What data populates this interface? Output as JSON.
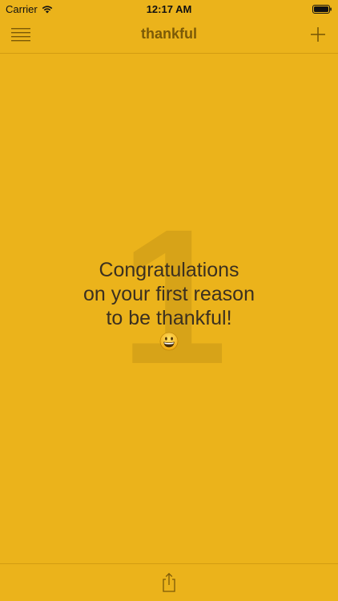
{
  "status_bar": {
    "carrier": "Carrier",
    "time": "12:17 AM",
    "battery_level": 1.0
  },
  "nav_bar": {
    "title": "thankful",
    "menu_icon": "hamburger-menu-icon",
    "add_icon": "plus-icon"
  },
  "content": {
    "background_number": "1",
    "message_lines": [
      "Congratulations",
      "on your first reason",
      "to be thankful!"
    ],
    "emoji": "grinning-face-emoji"
  },
  "bottom_bar": {
    "share_icon": "share-icon"
  },
  "colors": {
    "background": "#ebb31b",
    "accent": "#7c5a07",
    "number": "#d7a318"
  }
}
